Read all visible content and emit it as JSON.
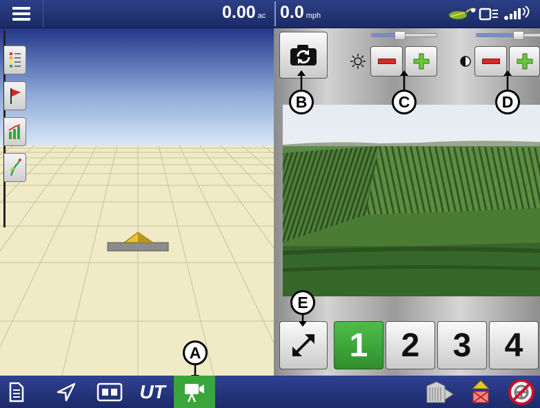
{
  "topbar": {
    "area_value": "0.00",
    "area_unit": "ac",
    "speed_value": "0.0",
    "speed_unit": "mph",
    "icons": [
      "menu-icon",
      "gps-signal-icon",
      "display-status-icon",
      "wireless-signal-icon"
    ]
  },
  "map": {
    "side_tabs": [
      "legend-icon",
      "flag-icon",
      "chart-icon",
      "guidance-icon"
    ],
    "vehicle_icon": "vehicle-icon"
  },
  "camera": {
    "snapshot_icon": "camera-refresh-icon",
    "brightness": {
      "icon": "brightness-icon",
      "level": 0.43,
      "minus": "−",
      "plus": "+"
    },
    "contrast": {
      "icon": "contrast-icon",
      "level": 0.64,
      "minus": "−",
      "plus": "+"
    },
    "expand_icon": "expand-icon",
    "channels": [
      "1",
      "2",
      "3",
      "4"
    ],
    "active_channel": "1"
  },
  "callouts": {
    "a": "A",
    "b": "B",
    "c": "C",
    "d": "D",
    "e": "E"
  },
  "bottombar": {
    "left_icons": [
      "document-icon",
      "navigation-icon",
      "split-view-icon",
      "ut-icon",
      "camera-icon"
    ],
    "ut_label": "UT",
    "right_icons": [
      "product-bin-icon",
      "headland-alert-icon",
      "steering-disabled-icon"
    ],
    "colors": {
      "bar": "#25358a",
      "active": "#3aa53a"
    }
  }
}
